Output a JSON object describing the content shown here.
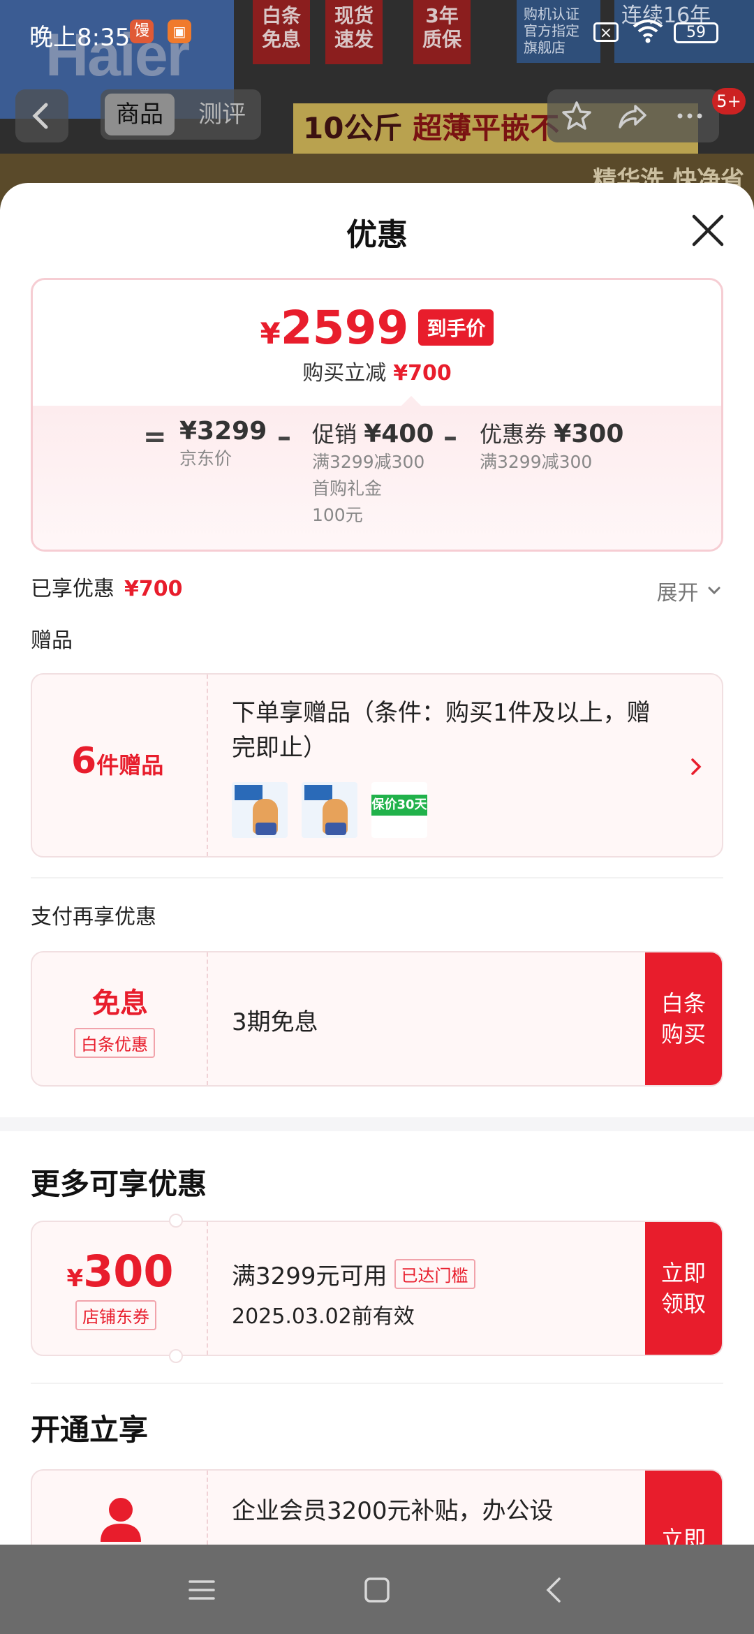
{
  "status_bar": {
    "time": "晚上8:35",
    "app1": "馒",
    "battery": "59"
  },
  "product_bg": {
    "brand": "Haier",
    "tags": [
      "白条\n免息",
      "现货\n速发",
      "3年\n质保"
    ],
    "tag_official": "购机认证\n官方指定\n旗舰店",
    "tag_years": "连续16年",
    "banner_prefix": "10公斤",
    "banner_main": "超薄平嵌不",
    "strip_text": "精华洗,快净省"
  },
  "product_header": {
    "tab_goods": "商品",
    "tab_review": "测评",
    "badge": "5+"
  },
  "sheet": {
    "title": "优惠",
    "price_card": {
      "yen": "¥",
      "final_price": "2599",
      "final_badge": "到手价",
      "reduce_label": "购买立减",
      "reduce_amount": "¥700",
      "jd_price": "¥3299",
      "jd_label": "京东价",
      "promo_label": "促销",
      "promo_amount": "¥400",
      "promo_sub1": "满3299减300",
      "promo_sub2": "首购礼金",
      "promo_sub3": "100元",
      "coupon_label": "优惠券",
      "coupon_amount": "¥300",
      "coupon_sub": "满3299减300",
      "eq": "=",
      "minus": "–"
    },
    "saved_label": "已享优惠",
    "saved_amount": "¥700",
    "expand_label": "展开",
    "gift_label": "赠品",
    "gift": {
      "count": "6",
      "count_unit": "件赠品",
      "desc": "下单享赠品（条件：购买1件及以上，赠完即止）",
      "green_thumb_label": "保价30天"
    },
    "pay_label": "支付再享优惠",
    "pay": {
      "title": "免息",
      "chip": "白条优惠",
      "desc": "3期免息",
      "cta": "白条购买"
    },
    "more_title": "更多可享优惠",
    "coupon": {
      "yen": "¥",
      "value": "300",
      "chip": "店铺东券",
      "condition": "满3299元可用",
      "met_badge": "已达门槛",
      "expiry": "2025.03.02前有效",
      "cta": "立即领取"
    },
    "open_title": "开通立享",
    "member": {
      "desc": "企业会员3200元补贴，办公设",
      "cta": "立即"
    }
  },
  "colors": {
    "accent": "#e81d2c",
    "card_bg": "#fff7f7",
    "navbar": "#6b6b6b"
  }
}
